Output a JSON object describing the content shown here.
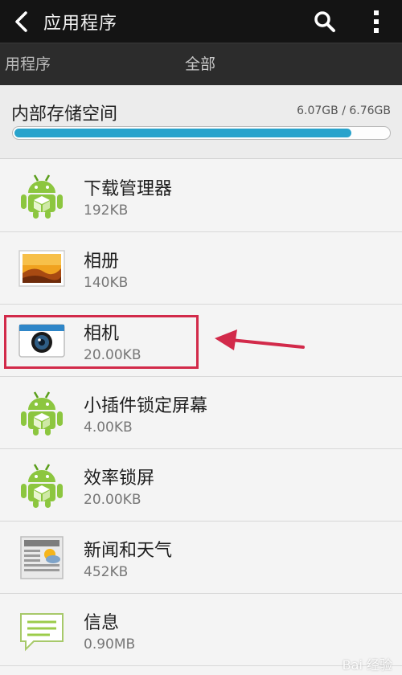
{
  "actionbar": {
    "title": "应用程序",
    "icons": {
      "back": "back-chevron-icon",
      "search": "search-icon",
      "menu": "overflow-menu-icon"
    }
  },
  "tabs": {
    "left_label": "用程序",
    "center_label": "全部"
  },
  "storage": {
    "title": "内部存储空间",
    "value": "6.07GB / 6.76GB",
    "used_fraction": 0.9,
    "bar_color": "#29a3cc"
  },
  "apps": [
    {
      "name": "下载管理器",
      "size": "192KB",
      "icon": "android-icon"
    },
    {
      "name": "相册",
      "size": "140KB",
      "icon": "gallery-icon"
    },
    {
      "name": "相机",
      "size": "20.00KB",
      "icon": "camera-icon"
    },
    {
      "name": "小插件锁定屏幕",
      "size": "4.00KB",
      "icon": "android-icon"
    },
    {
      "name": "效率锁屏",
      "size": "20.00KB",
      "icon": "android-icon"
    },
    {
      "name": "新闻和天气",
      "size": "452KB",
      "icon": "news-weather-icon"
    },
    {
      "name": "信息",
      "size": "0.90MB",
      "icon": "message-icon"
    }
  ],
  "annotation": {
    "highlight_color": "#d22a4a"
  },
  "watermark": {
    "text": "Bai 经验"
  }
}
